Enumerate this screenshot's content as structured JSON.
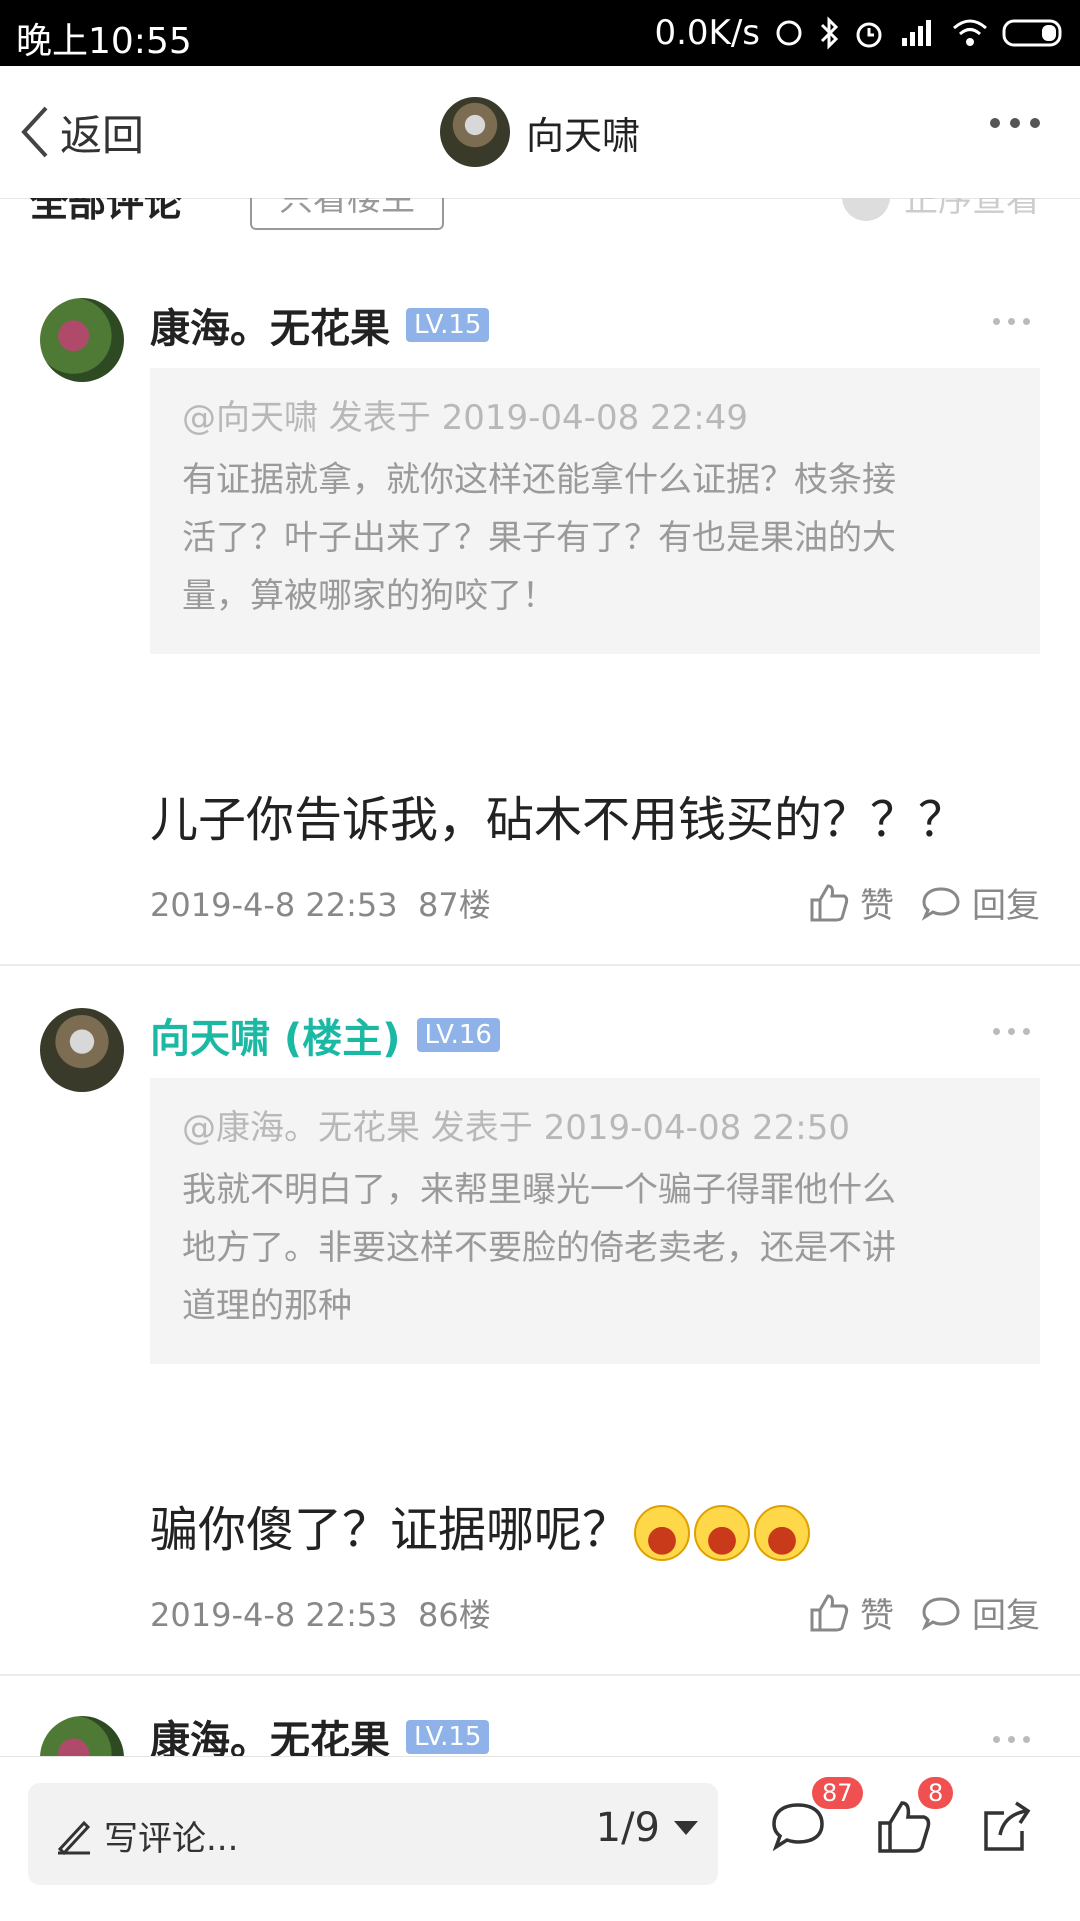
{
  "status_bar": {
    "time": "晚上10:55",
    "net_speed": "0.0K/s"
  },
  "header": {
    "back_label": "返回",
    "title": "向天啸"
  },
  "list_header": {
    "title": "全部评论",
    "filter_label": "只看楼主",
    "sort_label": "正序查看"
  },
  "comments": [
    {
      "name": "康海。无花果",
      "level": "LV.15",
      "owner": false,
      "quote_meta": "@向天啸 发表于 2019-04-08 22:49",
      "quote_lines": [
        "有证据就拿，就你这样还能拿什么证据？枝条接",
        "活了？叶子出来了？果子有了？有也是果油的大",
        "量，算被哪家的狗咬了！"
      ],
      "text": "儿子你告诉我，砧木不用钱买的？？？",
      "time": "2019-4-8 22:53",
      "floor": "87楼",
      "like_label": "赞",
      "reply_label": "回复"
    },
    {
      "name": "向天啸 (楼主)",
      "level": "LV.16",
      "owner": true,
      "quote_meta": "@康海。无花果 发表于 2019-04-08 22:50",
      "quote_lines": [
        "我就不明白了，来帮里曝光一个骗子得罪他什么",
        "地方了。非要这样不要脸的倚老卖老，还是不讲",
        "道理的那种"
      ],
      "text": "骗你傻了？证据哪呢？",
      "time": "2019-4-8 22:53",
      "floor": "86楼",
      "like_label": "赞",
      "reply_label": "回复"
    },
    {
      "name": "康海。无花果",
      "level": "LV.15"
    }
  ],
  "bottom_bar": {
    "placeholder": "写评论...",
    "page": "1/9",
    "comment_count": "87",
    "like_count": "8"
  },
  "colors": {
    "owner_name": "#1bb8a4",
    "level_badge": "#8fb3e8",
    "badge_red": "#f05050"
  }
}
